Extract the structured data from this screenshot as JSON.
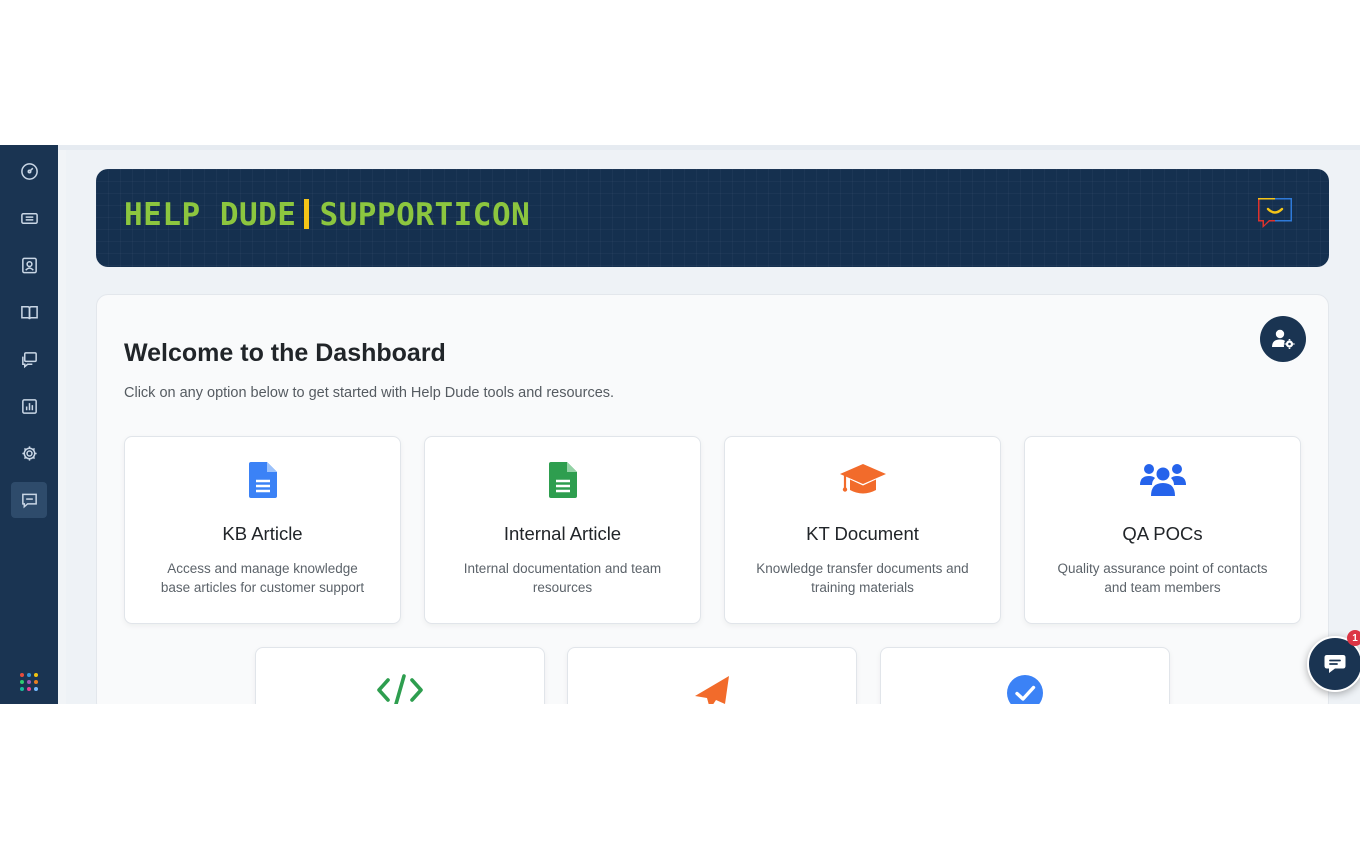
{
  "banner": {
    "title_left": "HELP DUDE",
    "title_right": "SUPPORTICON",
    "colors": {
      "background": "#15304f",
      "title": "#8cc63f",
      "separator": "#f5c518"
    }
  },
  "sidebar": {
    "items": [
      {
        "icon": "gauge-icon",
        "active": false
      },
      {
        "icon": "ticket-icon",
        "active": false
      },
      {
        "icon": "contact-icon",
        "active": false
      },
      {
        "icon": "book-icon",
        "active": false
      },
      {
        "icon": "messages-icon",
        "active": false
      },
      {
        "icon": "bar-chart-icon",
        "active": false
      },
      {
        "icon": "gear-icon",
        "active": false
      },
      {
        "icon": "chat-icon",
        "active": true
      }
    ],
    "apps_icon": "apps-grid-icon",
    "colors": {
      "background": "#1a3452"
    }
  },
  "dashboard": {
    "title": "Welcome to the Dashboard",
    "subtitle": "Click on any option below to get started with Help Dude tools and resources.",
    "admin_icon": "user-settings-icon",
    "cards": [
      {
        "title": "KB Article",
        "description": "Access and manage knowledge base articles for customer support",
        "icon": "document-icon",
        "color": "#3b82f6"
      },
      {
        "title": "Internal Article",
        "description": "Internal documentation and team resources",
        "icon": "document-icon",
        "color": "#2e9e4f"
      },
      {
        "title": "KT Document",
        "description": "Knowledge transfer documents and training materials",
        "icon": "graduation-cap-icon",
        "color": "#f26b2b"
      },
      {
        "title": "QA POCs",
        "description": "Quality assurance point of contacts and team members",
        "icon": "users-icon",
        "color": "#2563eb"
      },
      {
        "title": "",
        "description": "",
        "icon": "code-icon",
        "color": "#2e9e4f"
      },
      {
        "title": "",
        "description": "",
        "icon": "paper-plane-icon",
        "color": "#f26b2b"
      },
      {
        "title": "",
        "description": "",
        "icon": "check-circle-icon",
        "color": "#3b82f6"
      }
    ]
  },
  "chat_widget": {
    "badge_count": "1",
    "icon": "chat-bubble-icon"
  }
}
